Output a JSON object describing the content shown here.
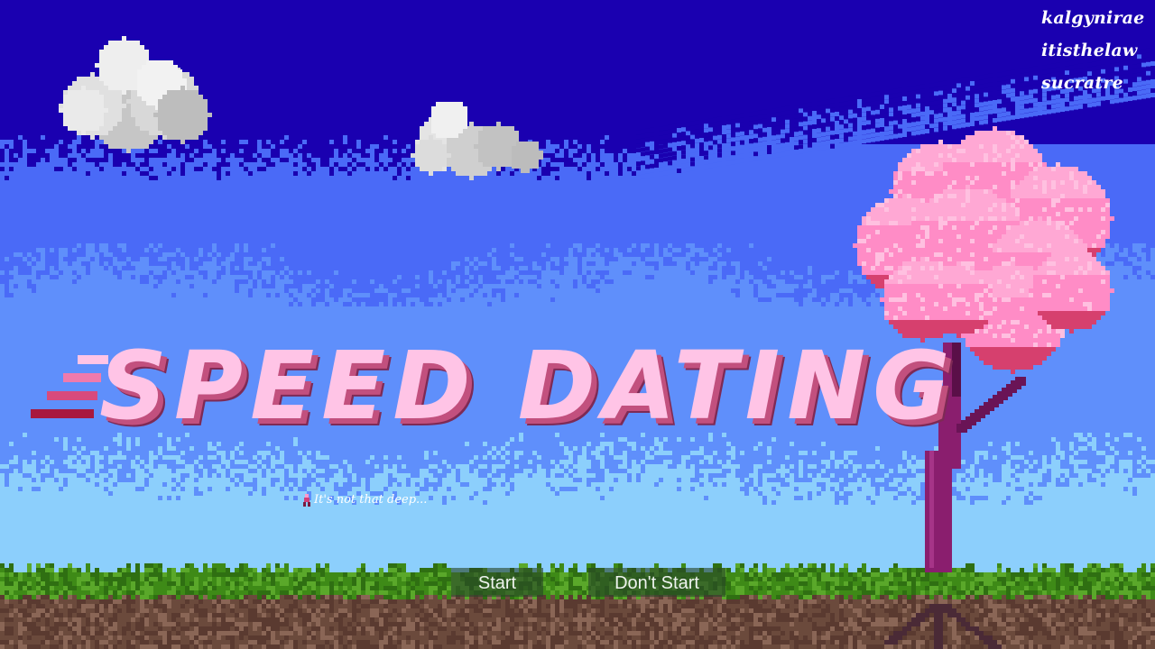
{
  "game": {
    "title": "SPEED DATING",
    "tagline": "It's not that deep...",
    "tagline_icon": "pink-figure-icon"
  },
  "credits": [
    "kalgynirae",
    "itisthelaw",
    "sucratre"
  ],
  "menu": {
    "start_label": "Start",
    "dont_start_label": "Don't Start"
  },
  "colors": {
    "sky_top": "#1a00b0",
    "sky_mid": "#4a6af7",
    "sky_low": "#8ccffc",
    "title_pink": "#ffc4e6",
    "title_shadow": "#c2507e",
    "grass": "#3e8a17",
    "dirt": "#6b4a3c",
    "blossom": "#ff8cc6",
    "trunk": "#8a1e6e"
  }
}
